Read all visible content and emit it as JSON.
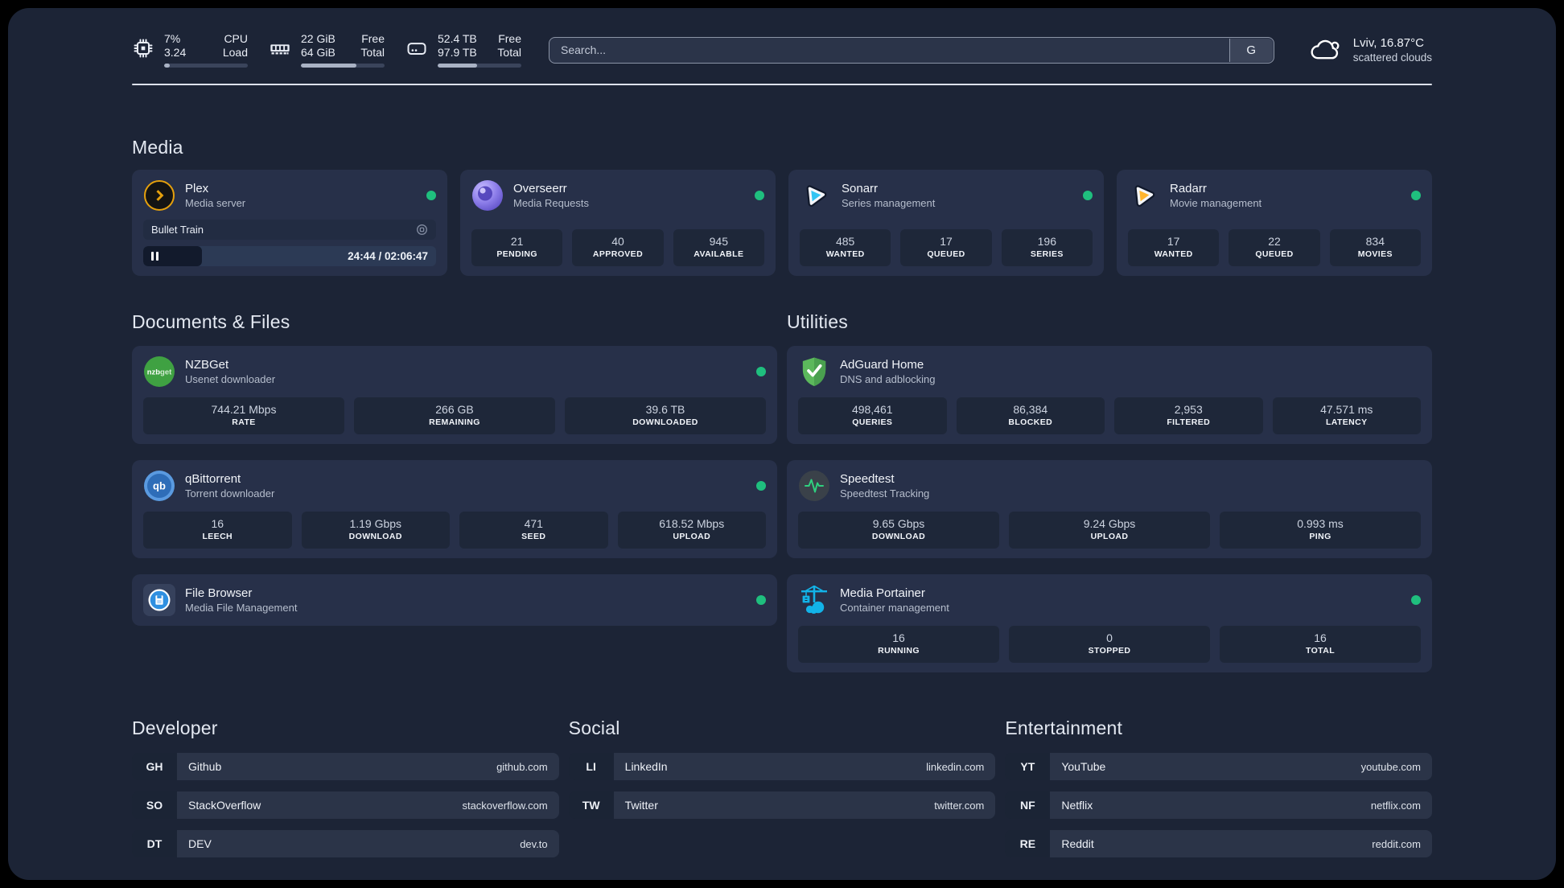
{
  "header": {
    "stats": [
      {
        "name": "cpu",
        "value_top": "7%",
        "value_bottom": "3.24",
        "label_top": "CPU",
        "label_bottom": "Load",
        "progress_width": "7%"
      },
      {
        "name": "memory",
        "value_top": "22 GiB",
        "value_bottom": "64 GiB",
        "label_top": "Free",
        "label_bottom": "Total",
        "progress_width": "66%"
      },
      {
        "name": "storage",
        "value_top": "52.4 TB",
        "value_bottom": "97.9 TB",
        "label_top": "Free",
        "label_bottom": "Total",
        "progress_width": "47%"
      }
    ],
    "search": {
      "placeholder": "Search...",
      "engine_button": "G"
    },
    "weather": {
      "location": "Lviv, 16.87°C",
      "condition": "scattered clouds"
    }
  },
  "media": {
    "title": "Media",
    "plex": {
      "title": "Plex",
      "subtitle": "Media server",
      "now_playing": "Bullet Train",
      "time_display": "24:44 / 02:06:47",
      "progress_width": "20%"
    },
    "overseerr": {
      "title": "Overseerr",
      "subtitle": "Media Requests",
      "stats": [
        {
          "value": "21",
          "label": "PENDING"
        },
        {
          "value": "40",
          "label": "APPROVED"
        },
        {
          "value": "945",
          "label": "AVAILABLE"
        }
      ]
    },
    "sonarr": {
      "title": "Sonarr",
      "subtitle": "Series management",
      "stats": [
        {
          "value": "485",
          "label": "WANTED"
        },
        {
          "value": "17",
          "label": "QUEUED"
        },
        {
          "value": "196",
          "label": "SERIES"
        }
      ]
    },
    "radarr": {
      "title": "Radarr",
      "subtitle": "Movie management",
      "stats": [
        {
          "value": "17",
          "label": "WANTED"
        },
        {
          "value": "22",
          "label": "QUEUED"
        },
        {
          "value": "834",
          "label": "MOVIES"
        }
      ]
    }
  },
  "documents": {
    "title": "Documents & Files",
    "nzbget": {
      "title": "NZBGet",
      "subtitle": "Usenet downloader",
      "stats": [
        {
          "value": "744.21 Mbps",
          "label": "RATE"
        },
        {
          "value": "266 GB",
          "label": "REMAINING"
        },
        {
          "value": "39.6 TB",
          "label": "DOWNLOADED"
        }
      ]
    },
    "qbittorrent": {
      "title": "qBittorrent",
      "subtitle": "Torrent downloader",
      "stats": [
        {
          "value": "16",
          "label": "LEECH"
        },
        {
          "value": "1.19 Gbps",
          "label": "DOWNLOAD"
        },
        {
          "value": "471",
          "label": "SEED"
        },
        {
          "value": "618.52 Mbps",
          "label": "UPLOAD"
        }
      ]
    },
    "filebrowser": {
      "title": "File Browser",
      "subtitle": "Media File Management"
    }
  },
  "utilities": {
    "title": "Utilities",
    "adguard": {
      "title": "AdGuard Home",
      "subtitle": "DNS and adblocking",
      "stats": [
        {
          "value": "498,461",
          "label": "QUERIES"
        },
        {
          "value": "86,384",
          "label": "BLOCKED"
        },
        {
          "value": "2,953",
          "label": "FILTERED"
        },
        {
          "value": "47.571 ms",
          "label": "LATENCY"
        }
      ]
    },
    "speedtest": {
      "title": "Speedtest",
      "subtitle": "Speedtest Tracking",
      "stats": [
        {
          "value": "9.65 Gbps",
          "label": "DOWNLOAD"
        },
        {
          "value": "9.24 Gbps",
          "label": "UPLOAD"
        },
        {
          "value": "0.993 ms",
          "label": "PING"
        }
      ]
    },
    "portainer": {
      "title": "Media Portainer",
      "subtitle": "Container management",
      "stats": [
        {
          "value": "16",
          "label": "RUNNING"
        },
        {
          "value": "0",
          "label": "STOPPED"
        },
        {
          "value": "16",
          "label": "TOTAL"
        }
      ]
    }
  },
  "links": {
    "developer": {
      "title": "Developer",
      "items": [
        {
          "abbr": "GH",
          "name": "Github",
          "url": "github.com"
        },
        {
          "abbr": "SO",
          "name": "StackOverflow",
          "url": "stackoverflow.com"
        },
        {
          "abbr": "DT",
          "name": "DEV",
          "url": "dev.to"
        }
      ]
    },
    "social": {
      "title": "Social",
      "items": [
        {
          "abbr": "LI",
          "name": "LinkedIn",
          "url": "linkedin.com"
        },
        {
          "abbr": "TW",
          "name": "Twitter",
          "url": "twitter.com"
        }
      ]
    },
    "entertainment": {
      "title": "Entertainment",
      "items": [
        {
          "abbr": "YT",
          "name": "YouTube",
          "url": "youtube.com"
        },
        {
          "abbr": "NF",
          "name": "Netflix",
          "url": "netflix.com"
        },
        {
          "abbr": "RE",
          "name": "Reddit",
          "url": "reddit.com"
        }
      ]
    }
  },
  "colors": {
    "status_online": "#1fbf7e",
    "plex": "#e5a00d",
    "overseerr": "#8b7ce8",
    "sonarr": "#31c4f3",
    "radarr": "#ffb52e",
    "nzbget": "#3fa142",
    "qbittorrent": "#2e6db8",
    "adguard": "#5cb85c",
    "speedtest_pulse": "#2fd07f",
    "portainer": "#12b3e8",
    "filebrowser": "#2f8fe0"
  }
}
